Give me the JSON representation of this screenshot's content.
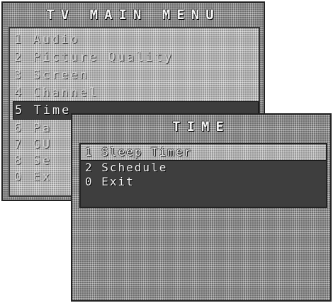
{
  "main_menu": {
    "title": "TV MAIN MENU",
    "items": [
      {
        "label": "1 Audio"
      },
      {
        "label": "2 Picture Quality"
      },
      {
        "label": "3 Screen"
      },
      {
        "label": "4 Channel"
      },
      {
        "label": "5 Time",
        "selected": true
      },
      {
        "label": "6 Pa"
      },
      {
        "label": "7 GU"
      },
      {
        "label": "8 Se"
      },
      {
        "label": "0 Ex"
      }
    ]
  },
  "time_menu": {
    "title": "TIME",
    "items": [
      {
        "label": "1 Sleep Timer",
        "selected": true
      },
      {
        "label": "2 Schedule"
      },
      {
        "label": "0 Exit"
      }
    ]
  }
}
